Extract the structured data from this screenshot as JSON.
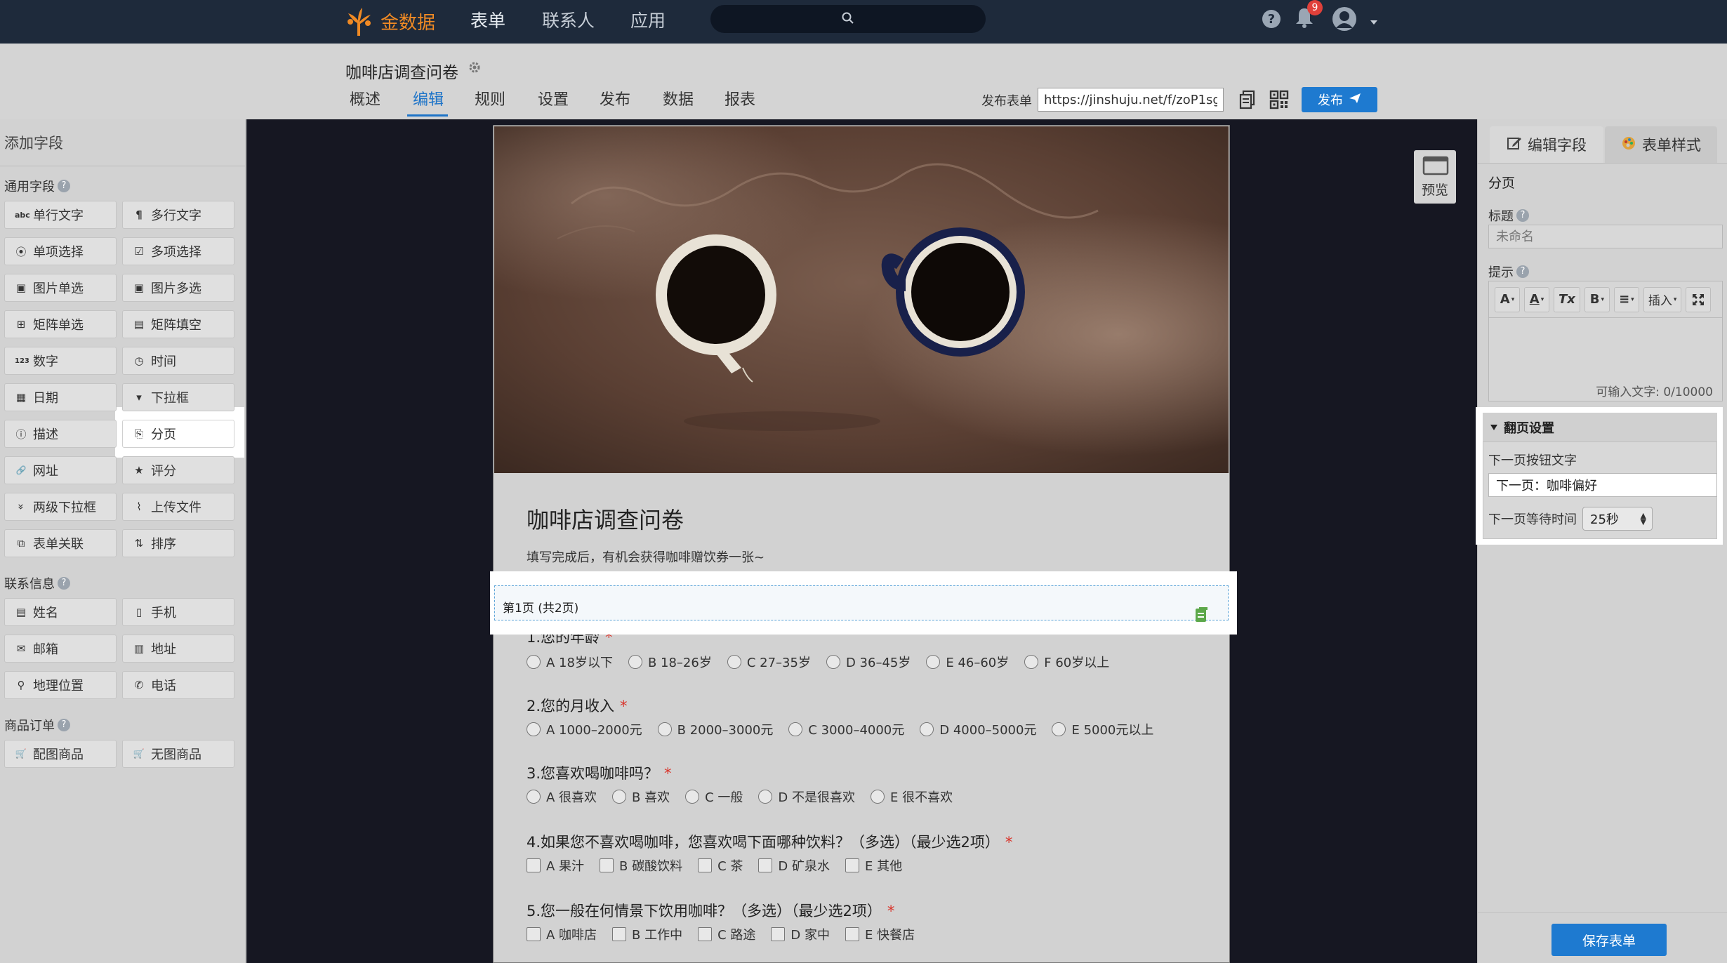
{
  "topnav": {
    "brand": "金数据",
    "links": [
      "表单",
      "联系人",
      "应用"
    ],
    "notification_count": "9"
  },
  "subhead": {
    "form_title": "咖啡店调查问卷",
    "tabs": [
      "概述",
      "编辑",
      "规则",
      "设置",
      "发布",
      "数据",
      "报表"
    ],
    "active_tab": "编辑",
    "publish_label": "发布表单",
    "publish_url": "https://jinshuju.net/f/zoP1sg",
    "publish_button": "发布"
  },
  "leftbar": {
    "title": "添加字段",
    "sections": [
      {
        "label": "通用字段",
        "fields": [
          {
            "label": "单行文字",
            "icon": "abc"
          },
          {
            "label": "多行文字",
            "icon": "¶"
          },
          {
            "label": "单项选择",
            "icon": "⦿"
          },
          {
            "label": "多项选择",
            "icon": "☑"
          },
          {
            "label": "图片单选",
            "icon": "▣"
          },
          {
            "label": "图片多选",
            "icon": "▣"
          },
          {
            "label": "矩阵单选",
            "icon": "⊞"
          },
          {
            "label": "矩阵填空",
            "icon": "▤"
          },
          {
            "label": "数字",
            "icon": "123"
          },
          {
            "label": "时间",
            "icon": "◷"
          },
          {
            "label": "日期",
            "icon": "▦"
          },
          {
            "label": "下拉框",
            "icon": "▾"
          },
          {
            "label": "描述",
            "icon": "ⓘ"
          },
          {
            "label": "分页",
            "icon": "⎘"
          },
          {
            "label": "网址",
            "icon": "🔗"
          },
          {
            "label": "评分",
            "icon": "★"
          },
          {
            "label": "两级下拉框",
            "icon": "»"
          },
          {
            "label": "上传文件",
            "icon": "⌇"
          },
          {
            "label": "表单关联",
            "icon": "⧉"
          },
          {
            "label": "排序",
            "icon": "⇅"
          }
        ]
      },
      {
        "label": "联系信息",
        "fields": [
          {
            "label": "姓名",
            "icon": "▤"
          },
          {
            "label": "手机",
            "icon": "▯"
          },
          {
            "label": "邮箱",
            "icon": "✉"
          },
          {
            "label": "地址",
            "icon": "▥"
          },
          {
            "label": "地理位置",
            "icon": "⚲"
          },
          {
            "label": "电话",
            "icon": "✆"
          }
        ]
      },
      {
        "label": "商品订单",
        "fields": [
          {
            "label": "配图商品",
            "icon": "🛒"
          },
          {
            "label": "无图商品",
            "icon": "🛒"
          }
        ]
      }
    ]
  },
  "form": {
    "title": "咖啡店调查问卷",
    "description": "填写完成后，有机会获得咖啡赠饮券一张~",
    "pager": "第1页 (共2页)",
    "questions": [
      {
        "title": "1.您的年龄",
        "type": "radio",
        "options": [
          "A 18岁以下",
          "B 18–26岁",
          "C 27–35岁",
          "D 36–45岁",
          "E 46–60岁",
          "F 60岁以上"
        ]
      },
      {
        "title": "2.您的月收入",
        "type": "radio",
        "options": [
          "A 1000–2000元",
          "B 2000–3000元",
          "C 3000–4000元",
          "D 4000–5000元",
          "E 5000元以上"
        ]
      },
      {
        "title": "3.您喜欢喝咖啡吗？",
        "type": "radio",
        "options": [
          "A 很喜欢",
          "B 喜欢",
          "C 一般",
          "D 不是很喜欢",
          "E 很不喜欢"
        ]
      },
      {
        "title": "4.如果您不喜欢喝咖啡，您喜欢喝下面哪种饮料？（多选）（最少选2项）",
        "type": "checkbox",
        "options": [
          "A 果汁",
          "B 碳酸饮料",
          "C 茶",
          "D 矿泉水",
          "E 其他"
        ]
      },
      {
        "title": "5.您一般在何情景下饮用咖啡？（多选）（最少选2项）",
        "type": "checkbox",
        "options": [
          "A 咖啡店",
          "B 工作中",
          "C 路途",
          "D 家中",
          "E 快餐店"
        ]
      }
    ],
    "required_mark": "*"
  },
  "preview": {
    "label": "预览"
  },
  "rightbar": {
    "tabs": [
      "编辑字段",
      "表单样式"
    ],
    "heading": "分页",
    "title_label": "标题",
    "title_placeholder": "未命名",
    "hint_label": "提示",
    "toolbar": [
      "A",
      "A",
      "Tx",
      "B",
      "≡",
      "插入"
    ],
    "counter": "可输入文字: 0/10000",
    "flip": {
      "header": "翻页设置",
      "next_label": "下一页按钮文字",
      "next_value": "下一页：咖啡偏好",
      "wait_label": "下一页等待时间",
      "wait_value": "25秒"
    },
    "save_button": "保存表单"
  },
  "colors": {
    "nav_bg": "#1e2a3b",
    "brand": "#f08a24",
    "accent": "#1e7ad0",
    "required": "#d9342b",
    "badge": "#e0403a"
  }
}
